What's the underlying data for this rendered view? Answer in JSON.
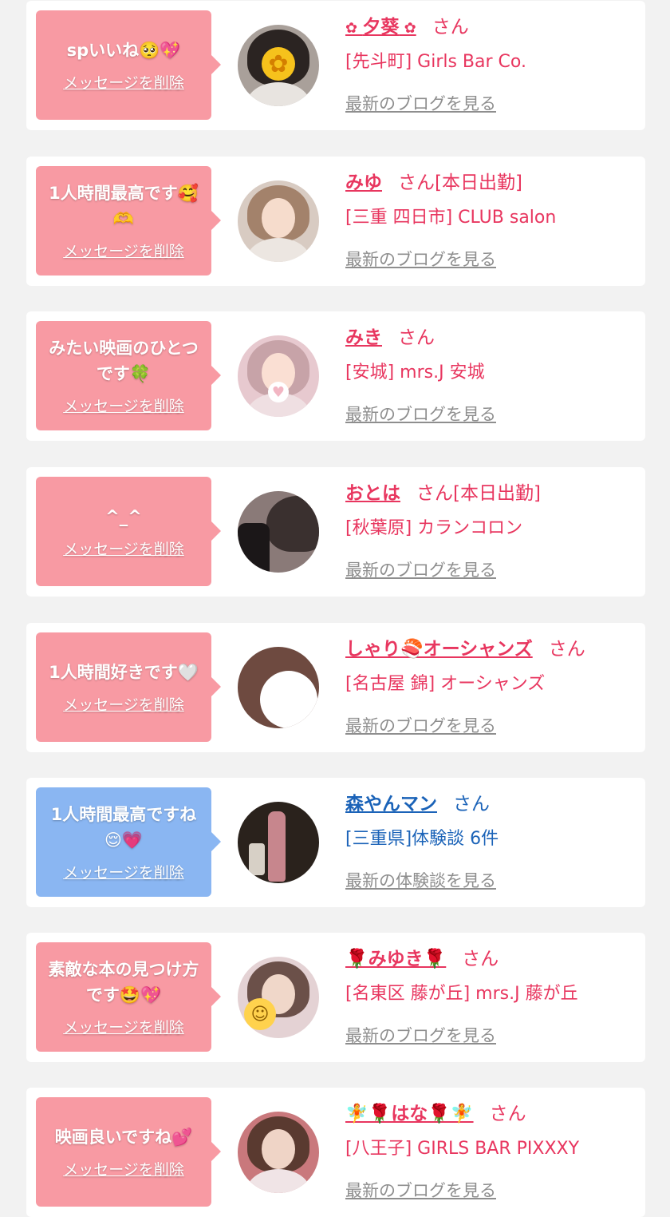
{
  "delete_label": "メッセージを削除",
  "colors": {
    "pink_bubble": "#f89aa3",
    "blue_bubble": "#8ab6f2",
    "pink_text": "#e8365f",
    "blue_text": "#1b63b8",
    "link_gray": "#8e8e8e"
  },
  "items": [
    {
      "message": "spいいね🥺💖",
      "name": "夕葵",
      "name_prefix_icon": "flower-icon",
      "honorific": "さん",
      "shop": "[先斗町] Girls Bar Co.",
      "blog_link": "最新のブログを見る",
      "theme": "pink"
    },
    {
      "message": "1人時間最高です🥰🫶",
      "name": "みゆ",
      "honorific": "さん[本日出勤]",
      "shop": "[三重 四日市] CLUB salon",
      "blog_link": "最新のブログを見る",
      "theme": "pink"
    },
    {
      "message": "みたい映画のひとつです🍀",
      "name": "みき",
      "honorific": "さん",
      "shop": "[安城] mrs.J 安城",
      "blog_link": "最新のブログを見る",
      "theme": "pink"
    },
    {
      "message": "^_^",
      "name": "おとは",
      "honorific": "さん[本日出勤]",
      "shop": "[秋葉原] カランコロン",
      "blog_link": "最新のブログを見る",
      "theme": "pink"
    },
    {
      "message": "1人時間好きです🤍",
      "name": "しゃり🍣オーシャンズ",
      "honorific": "さん",
      "shop": "[名古屋 錦] オーシャンズ",
      "blog_link": "最新のブログを見る",
      "theme": "pink"
    },
    {
      "message": "1人時間最高ですね😌💗",
      "name": "森やんマン",
      "honorific": "さん",
      "shop": "[三重県]体験談 6件",
      "blog_link": "最新の体験談を見る",
      "theme": "blue"
    },
    {
      "message": "素敵な本の見つけ方です🤩💖",
      "name": "🌹みゆき🌹",
      "honorific": "さん",
      "shop": "[名東区 藤が丘] mrs.J 藤が丘",
      "blog_link": "最新のブログを見る",
      "theme": "pink"
    },
    {
      "message": "映画良いですね💕",
      "name": "🧚🌹はな🌹🧚",
      "honorific": "さん",
      "shop": "[八王子] GIRLS BAR PIXXXY",
      "blog_link": "最新のブログを見る",
      "theme": "pink"
    }
  ]
}
